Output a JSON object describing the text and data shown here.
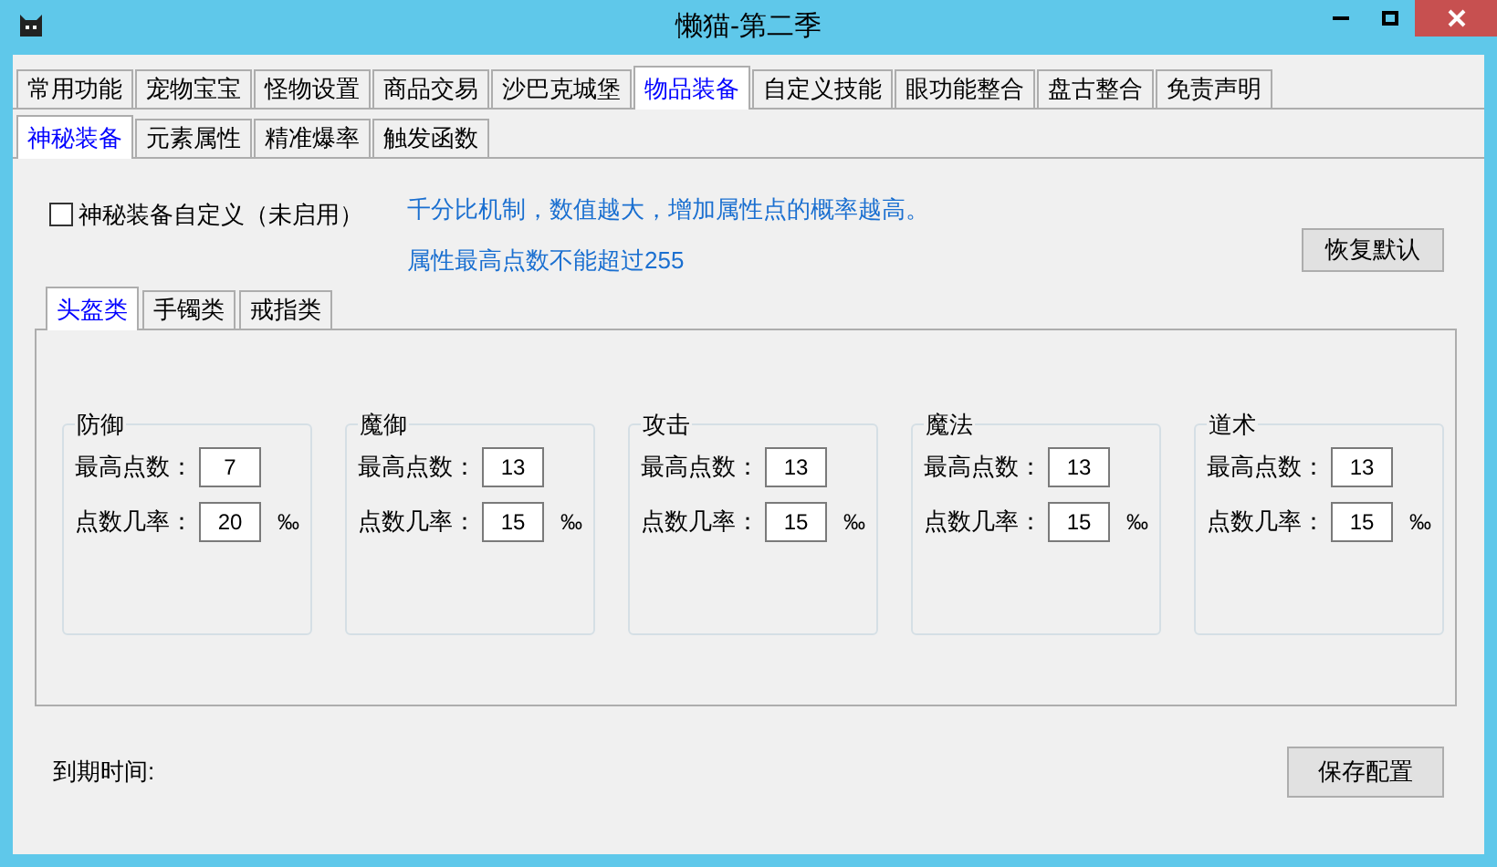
{
  "window": {
    "title": "懒猫-第二季"
  },
  "tabs": [
    {
      "label": "常用功能",
      "selected": false
    },
    {
      "label": "宠物宝宝",
      "selected": false
    },
    {
      "label": "怪物设置",
      "selected": false
    },
    {
      "label": "商品交易",
      "selected": false
    },
    {
      "label": "沙巴克城堡",
      "selected": false
    },
    {
      "label": "物品装备",
      "selected": true
    },
    {
      "label": "自定义技能",
      "selected": false
    },
    {
      "label": "眼功能整合",
      "selected": false
    },
    {
      "label": "盘古整合",
      "selected": false
    },
    {
      "label": "免责声明",
      "selected": false
    }
  ],
  "sub_tabs": [
    {
      "label": "神秘装备",
      "selected": true
    },
    {
      "label": "元素属性",
      "selected": false
    },
    {
      "label": "精准爆率",
      "selected": false
    },
    {
      "label": "触发函数",
      "selected": false
    }
  ],
  "custom_checkbox": {
    "label": "神秘装备自定义（未启用）",
    "checked": false
  },
  "notes": [
    "千分比机制，数值越大，增加属性点的概率越高。",
    "属性最高点数不能超过255"
  ],
  "reset_button": "恢复默认",
  "category_tabs": [
    {
      "label": "头盔类",
      "selected": true
    },
    {
      "label": "手镯类",
      "selected": false
    },
    {
      "label": "戒指类",
      "selected": false
    }
  ],
  "groups": [
    {
      "title": "防御",
      "max_label": "最高点数：",
      "max_value": "7",
      "rate_label": "点数几率：",
      "rate_value": "20",
      "unit": "‰"
    },
    {
      "title": "魔御",
      "max_label": "最高点数：",
      "max_value": "13",
      "rate_label": "点数几率：",
      "rate_value": "15",
      "unit": "‰"
    },
    {
      "title": "攻击",
      "max_label": "最高点数：",
      "max_value": "13",
      "rate_label": "点数几率：",
      "rate_value": "15",
      "unit": "‰"
    },
    {
      "title": "魔法",
      "max_label": "最高点数：",
      "max_value": "13",
      "rate_label": "点数几率：",
      "rate_value": "15",
      "unit": "‰"
    },
    {
      "title": "道术",
      "max_label": "最高点数：",
      "max_value": "13",
      "rate_label": "点数几率：",
      "rate_value": "15",
      "unit": "‰"
    }
  ],
  "expiry_label": "到期时间:",
  "save_button": "保存配置"
}
